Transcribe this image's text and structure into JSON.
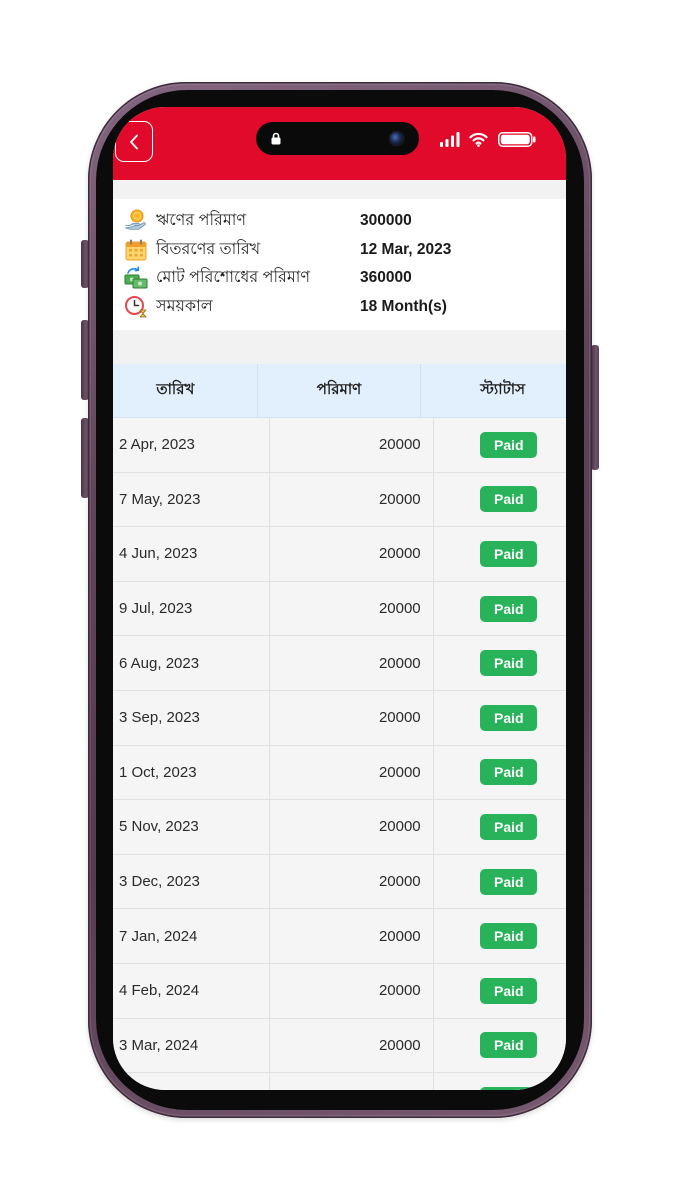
{
  "header": {
    "back_icon": "chevron-left-icon"
  },
  "status_bar": {
    "island_icons": [
      "lock-icon",
      "front-camera"
    ],
    "right_icons": [
      "cellular-signal-icon",
      "wifi-icon",
      "battery-icon"
    ]
  },
  "loan_summary": {
    "items": [
      {
        "icon": "coin-hand-icon",
        "label": "ঋণের পরিমাণ",
        "value": "300000"
      },
      {
        "icon": "calendar-icon",
        "label": "বিতরণের তারিখ",
        "value": "12 Mar, 2023"
      },
      {
        "icon": "money-exchange-icon",
        "label": "মোট পরিশোধের পরিমাণ",
        "value": "360000"
      },
      {
        "icon": "clock-icon",
        "label": "সময়কাল",
        "value": "18 Month(s)"
      }
    ]
  },
  "schedule": {
    "columns": [
      "তারিখ",
      "পরিমাণ",
      "স্ট্যাটাস"
    ],
    "rows": [
      {
        "date": "2 Apr, 2023",
        "amount": "20000",
        "status": "Paid"
      },
      {
        "date": "7 May, 2023",
        "amount": "20000",
        "status": "Paid"
      },
      {
        "date": "4 Jun, 2023",
        "amount": "20000",
        "status": "Paid"
      },
      {
        "date": "9 Jul, 2023",
        "amount": "20000",
        "status": "Paid"
      },
      {
        "date": "6 Aug, 2023",
        "amount": "20000",
        "status": "Paid"
      },
      {
        "date": "3 Sep, 2023",
        "amount": "20000",
        "status": "Paid"
      },
      {
        "date": "1 Oct, 2023",
        "amount": "20000",
        "status": "Paid"
      },
      {
        "date": "5 Nov, 2023",
        "amount": "20000",
        "status": "Paid"
      },
      {
        "date": "3 Dec, 2023",
        "amount": "20000",
        "status": "Paid"
      },
      {
        "date": "7 Jan, 2024",
        "amount": "20000",
        "status": "Paid"
      },
      {
        "date": "4 Feb, 2024",
        "amount": "20000",
        "status": "Paid"
      },
      {
        "date": "3 Mar, 2024",
        "amount": "20000",
        "status": "Paid"
      }
    ]
  },
  "colors": {
    "header": "#e20a2b",
    "table_header": "#e2effc",
    "status_paid": "#28b35a",
    "device_frame": "#5f455a"
  }
}
